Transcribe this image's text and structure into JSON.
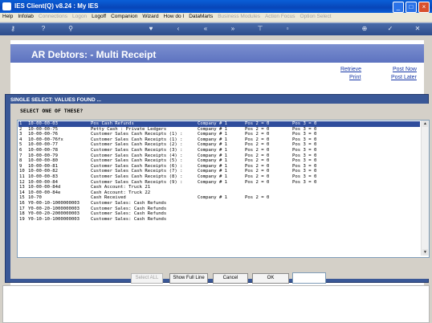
{
  "window": {
    "title": "IES Client(Q) v8.24 : My IES"
  },
  "menu": [
    {
      "label": "Help",
      "enabled": true
    },
    {
      "label": "Infolab",
      "enabled": true
    },
    {
      "label": "Connections",
      "enabled": false
    },
    {
      "label": "Logon",
      "enabled": false
    },
    {
      "label": "Logoff",
      "enabled": true
    },
    {
      "label": "Companion",
      "enabled": true
    },
    {
      "label": "Wizard",
      "enabled": true
    },
    {
      "label": "How do I",
      "enabled": true
    },
    {
      "label": "DataMarts",
      "enabled": true
    },
    {
      "label": "Business Modules",
      "enabled": false
    },
    {
      "label": "Action Focus",
      "enabled": false
    },
    {
      "label": "Option Select",
      "enabled": false
    }
  ],
  "page": {
    "title": "AR Debtors: - Multi Receipt",
    "links": {
      "retrieve": "Retrieve",
      "post_now": "Post Now",
      "print": "Print",
      "post_later": "Post Later"
    }
  },
  "dialog": {
    "title": "SINGLE SELECT: VALUES FOUND ...",
    "heading": "SELECT ONE OF THESE?",
    "buttons": {
      "select_all": "Select ALL",
      "show_full_line": "Show Full Line",
      "cancel": "Cancel",
      "ok": "OK"
    },
    "rows": [
      [
        "1",
        "10-00-00-03",
        "Pos Cash Refunds",
        "Company # 1",
        "Pos 2 = 0",
        "Pos 3 = 0"
      ],
      [
        "2",
        "10-00-00-75",
        "Petty Cash : Private Ledgers",
        "Company # 1",
        "Pos 2 = 0",
        "Pos 3 = 0"
      ],
      [
        "3",
        "10-00-00-76",
        "Customer Sales Cash Receipts (1) :",
        "Company # 1",
        "Pos 2 = 0",
        "Pos 3 = 0"
      ],
      [
        "4",
        "10-00-00-76fx",
        "Customer Sales Cash Receipts (1) :",
        "Company # 1",
        "Pos 2 = 0",
        "Pos 3 = 0"
      ],
      [
        "5",
        "10-00-00-77",
        "Customer Sales Cash Receipts (2) :",
        "Company # 1",
        "Pos 2 = 0",
        "Pos 3 = 0"
      ],
      [
        "6",
        "10-00-00-78",
        "Customer Sales Cash Receipts (3) :",
        "Company # 1",
        "Pos 2 = 0",
        "Pos 3 = 0"
      ],
      [
        "7",
        "10-00-00-79",
        "Customer Sales Cash Receipts (4) :",
        "Company # 1",
        "Pos 2 = 0",
        "Pos 3 = 0"
      ],
      [
        "8",
        "10-00-00-80",
        "Customer Sales Cash Receipts (5) :",
        "Company # 1",
        "Pos 2 = 0",
        "Pos 3 = 0"
      ],
      [
        "9",
        "10-00-00-81",
        "Customer Sales Cash Receipts (6) :",
        "Company # 1",
        "Pos 2 = 0",
        "Pos 3 = 0"
      ],
      [
        "10",
        "10-00-00-82",
        "Customer Sales Cash Receipts (7) :",
        "Company # 1",
        "Pos 2 = 0",
        "Pos 3 = 0"
      ],
      [
        "11",
        "10-00-00-83",
        "Customer Sales Cash Receipts (8) :",
        "Company # 1",
        "Pos 2 = 0",
        "Pos 3 = 0"
      ],
      [
        "12",
        "10-00-00-84",
        "Customer Sales Cash Receipts (9) :",
        "Company # 1",
        "Pos 2 = 0",
        "Pos 3 = 0"
      ],
      [
        "13",
        "10-00-00-84d",
        "Cash Account: Truck 21",
        "",
        "",
        ""
      ],
      [
        "14",
        "10-00-00-84e",
        "Cash Account: Truck 22",
        "",
        "",
        ""
      ],
      [
        "15",
        "10-70",
        "Cash Received",
        "Company # 1",
        "Pos 2 = 0",
        ""
      ],
      [
        "16",
        "Y0-00-10-1000000003",
        "Customer Sales: Cash Refunds",
        "",
        "",
        ""
      ],
      [
        "17",
        "Y0-00-20-1000000003",
        "Customer Sales: Cash Refunds",
        "",
        "",
        ""
      ],
      [
        "18",
        "Y0-00-20-2000000003",
        "Customer Sales: Cash Refunds",
        "",
        "",
        ""
      ],
      [
        "19",
        "Y0-10-10-1000000003",
        "Customer Sales: Cash Refunds",
        "",
        "",
        ""
      ]
    ]
  }
}
